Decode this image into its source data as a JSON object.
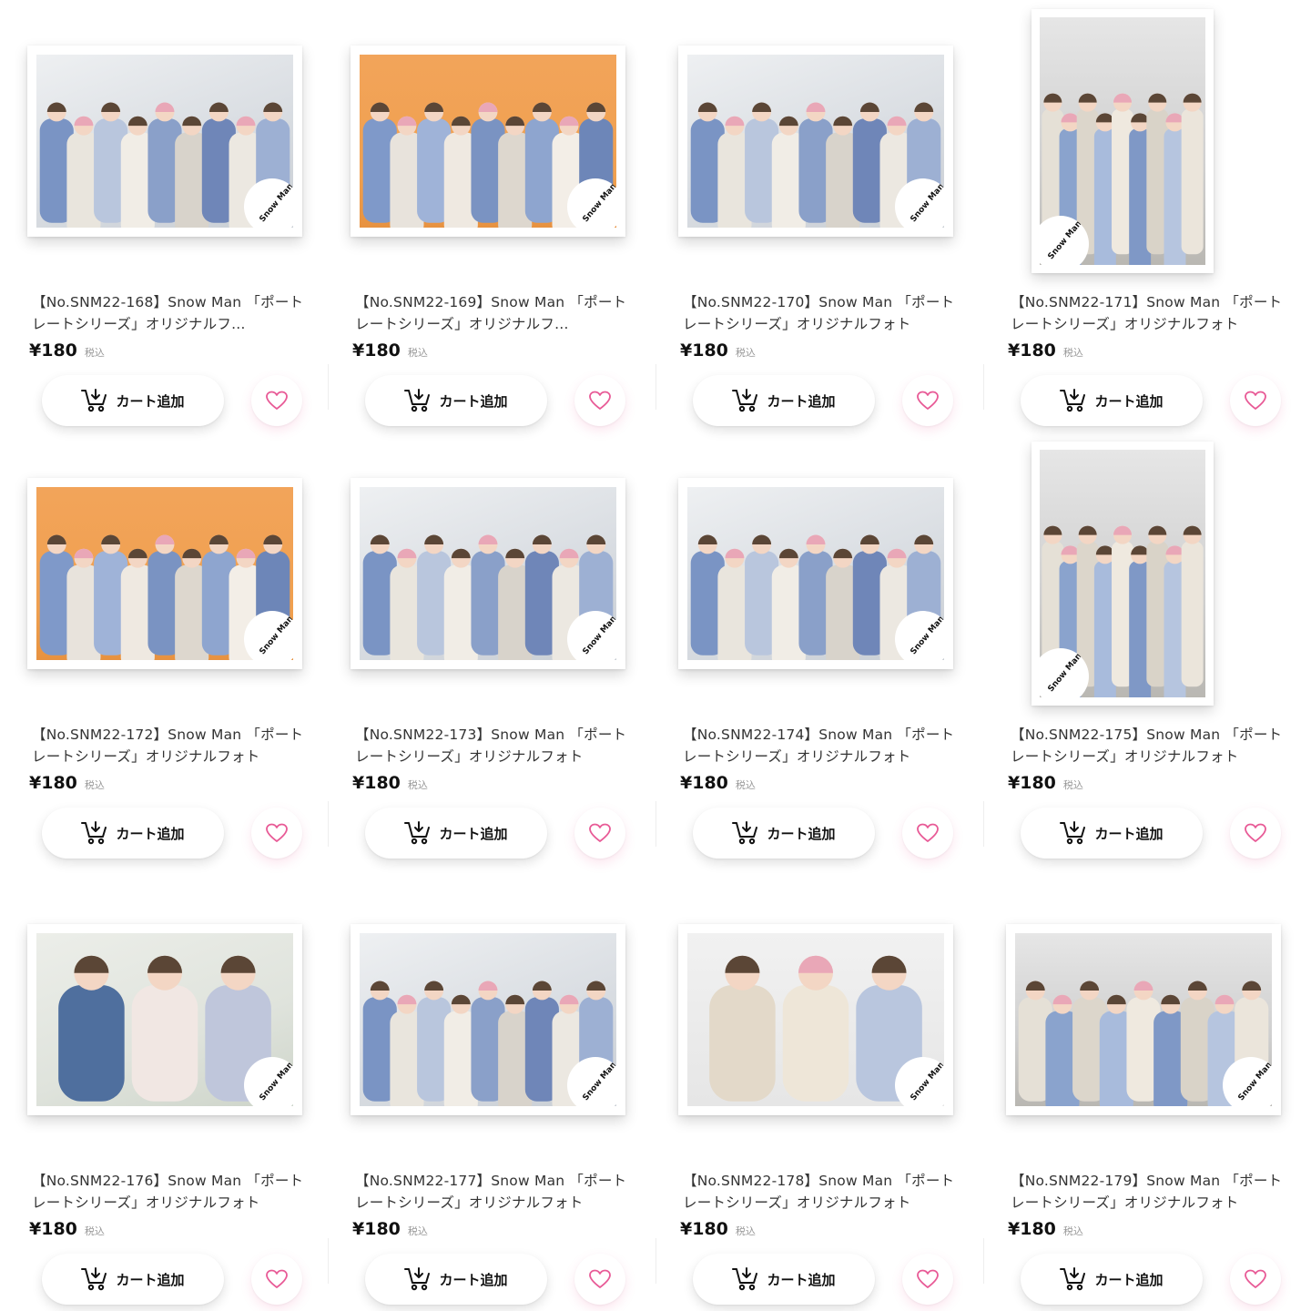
{
  "products": [
    {
      "title": "【No.SNM22-168】Snow Man 「ポートレートシリーズ」オリジナルフ…",
      "price": "¥180",
      "tax": "税込",
      "cart_label": "カート追加",
      "logo": "Snow Man",
      "scene": "gray",
      "orientation": "landscape"
    },
    {
      "title": "【No.SNM22-169】Snow Man 「ポートレートシリーズ」オリジナルフ…",
      "price": "¥180",
      "tax": "税込",
      "cart_label": "カート追加",
      "logo": "Snow Man",
      "scene": "orange",
      "orientation": "landscape"
    },
    {
      "title": "【No.SNM22-170】Snow Man 「ポートレートシリーズ」オリジナルフォト",
      "price": "¥180",
      "tax": "税込",
      "cart_label": "カート追加",
      "logo": "Snow Man",
      "scene": "gray",
      "orientation": "landscape"
    },
    {
      "title": "【No.SNM22-171】Snow Man 「ポートレートシリーズ」オリジナルフォト",
      "price": "¥180",
      "tax": "税込",
      "cart_label": "カート追加",
      "logo": "Snow Man",
      "scene": "stairs",
      "orientation": "portrait"
    },
    {
      "title": "【No.SNM22-172】Snow Man 「ポートレートシリーズ」オリジナルフォト",
      "price": "¥180",
      "tax": "税込",
      "cart_label": "カート追加",
      "logo": "Snow Man",
      "scene": "orange",
      "orientation": "landscape"
    },
    {
      "title": "【No.SNM22-173】Snow Man 「ポートレートシリーズ」オリジナルフォト",
      "price": "¥180",
      "tax": "税込",
      "cart_label": "カート追加",
      "logo": "Snow Man",
      "scene": "gray",
      "orientation": "landscape"
    },
    {
      "title": "【No.SNM22-174】Snow Man 「ポートレートシリーズ」オリジナルフォト",
      "price": "¥180",
      "tax": "税込",
      "cart_label": "カート追加",
      "logo": "Snow Man",
      "scene": "gray",
      "orientation": "landscape"
    },
    {
      "title": "【No.SNM22-175】Snow Man 「ポートレートシリーズ」オリジナルフォト",
      "price": "¥180",
      "tax": "税込",
      "cart_label": "カート追加",
      "logo": "Snow Man",
      "scene": "stairs",
      "orientation": "portrait"
    },
    {
      "title": "【No.SNM22-176】Snow Man 「ポートレートシリーズ」オリジナルフォト",
      "price": "¥180",
      "tax": "税込",
      "cart_label": "カート追加",
      "logo": "Snow Man",
      "scene": "plant",
      "orientation": "landscape"
    },
    {
      "title": "【No.SNM22-177】Snow Man 「ポートレートシリーズ」オリジナルフォト",
      "price": "¥180",
      "tax": "税込",
      "cart_label": "カート追加",
      "logo": "Snow Man",
      "scene": "gray",
      "orientation": "landscape"
    },
    {
      "title": "【No.SNM22-178】Snow Man 「ポートレートシリーズ」オリジナルフォト",
      "price": "¥180",
      "tax": "税込",
      "cart_label": "カート追加",
      "logo": "Snow Man",
      "scene": "white",
      "orientation": "landscape"
    },
    {
      "title": "【No.SNM22-179】Snow Man 「ポートレートシリーズ」オリジナルフォト",
      "price": "¥180",
      "tax": "税込",
      "cart_label": "カート追加",
      "logo": "Snow Man",
      "scene": "stairs",
      "orientation": "landscape"
    }
  ],
  "colors": {
    "heart": "#e85a96",
    "text": "#333333",
    "price": "#111111",
    "tax": "#999999"
  },
  "icons": {
    "cart": "cart-icon",
    "favorite": "heart-icon"
  }
}
